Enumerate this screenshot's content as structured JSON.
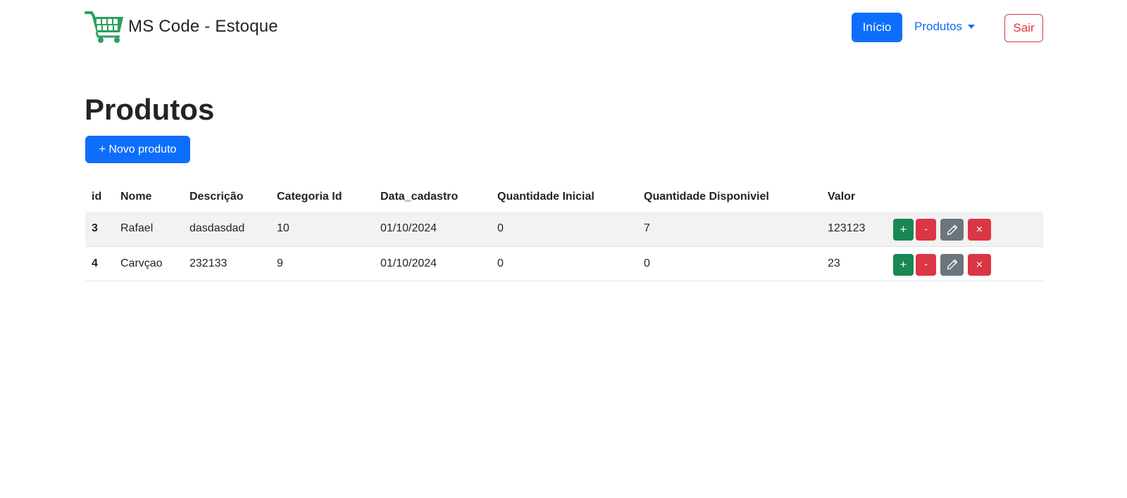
{
  "app": {
    "brand": "MS Code - Estoque",
    "brand_icon": "shopping-cart-icon",
    "brand_color": "#2e9e5e"
  },
  "nav": {
    "inicio": "Início",
    "produtos": "Produtos",
    "sair": "Sair"
  },
  "page": {
    "title": "Produtos",
    "new_button": "+ Novo produto"
  },
  "table": {
    "headers": [
      "id",
      "Nome",
      "Descrição",
      "Categoria Id",
      "Data_cadastro",
      "Quantidade Inicial",
      "Quantidade Disponiviel",
      "Valor",
      ""
    ],
    "rows": [
      {
        "id": "3",
        "nome": "Rafael",
        "descricao": "dasdasdad",
        "categoria_id": "10",
        "data_cadastro": "01/10/2024",
        "quantidade_inicial": "0",
        "quantidade_disponivel": "7",
        "valor": "123123"
      },
      {
        "id": "4",
        "nome": "Carvçao",
        "descricao": "232133",
        "categoria_id": "9",
        "data_cadastro": "01/10/2024",
        "quantidade_inicial": "0",
        "quantidade_disponivel": "0",
        "valor": "23"
      }
    ],
    "actions": {
      "add": "+",
      "remove": "-",
      "edit_icon": "pencil-icon",
      "delete": "×"
    }
  },
  "colors": {
    "primary": "#0d6efd",
    "success": "#198754",
    "danger": "#dc3545",
    "secondary": "#6c757d"
  }
}
